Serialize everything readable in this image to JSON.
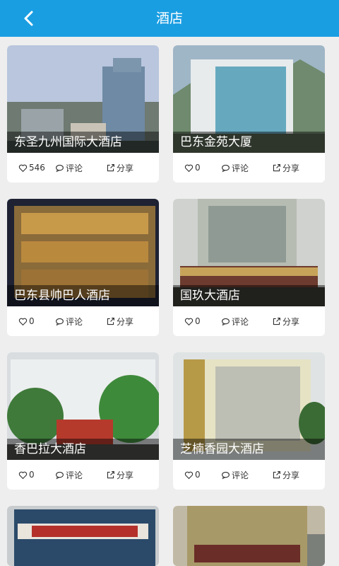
{
  "header": {
    "title": "酒店",
    "back_icon": "chevron-left-icon"
  },
  "colors": {
    "header_bg": "#1a9ee2",
    "page_bg": "#eeeeee"
  },
  "hotels": [
    {
      "name": "东圣九州国际大酒店",
      "likes": "546",
      "comment_label": "评论",
      "share_label": "分享"
    },
    {
      "name": "巴东金苑大厦",
      "likes": "0",
      "comment_label": "评论",
      "share_label": "分享"
    },
    {
      "name": "巴东县帅巴人酒店",
      "likes": "0",
      "comment_label": "评论",
      "share_label": "分享"
    },
    {
      "name": "国玖大酒店",
      "likes": "0",
      "comment_label": "评论",
      "share_label": "分享"
    },
    {
      "name": "香巴拉大酒店",
      "likes": "0",
      "comment_label": "评论",
      "share_label": "分享"
    },
    {
      "name": "芝楠香园大酒店",
      "likes": "0",
      "comment_label": "评论",
      "share_label": "分享"
    },
    {
      "name": "",
      "likes": "",
      "comment_label": "",
      "share_label": ""
    },
    {
      "name": "",
      "likes": "",
      "comment_label": "",
      "share_label": ""
    }
  ]
}
